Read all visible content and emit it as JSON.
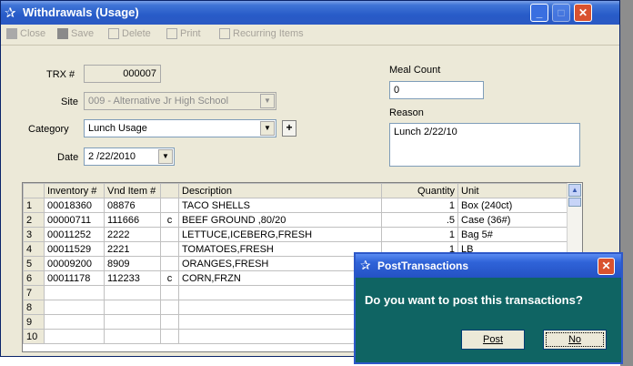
{
  "window": {
    "title": "Withdrawals (Usage)",
    "min": "_",
    "max": "□",
    "close": "✕"
  },
  "toolbar": {
    "close": "Close",
    "save": "Save",
    "delete": "Delete",
    "print": "Print",
    "recurring": "Recurring Items"
  },
  "form": {
    "trx_label": "TRX #",
    "trx_value": "000007",
    "site_label": "Site",
    "site_value": "009 - Alternative Jr High School",
    "category_label": "Category",
    "category_value": "Lunch Usage",
    "category_plus": "+",
    "date_label": "Date",
    "date_value": "2 /22/2010",
    "meal_count_label": "Meal Count",
    "meal_count_value": "0",
    "reason_label": "Reason",
    "reason_value": "Lunch 2/22/10"
  },
  "grid": {
    "columns": [
      "Inventory #",
      "Vnd Item #",
      "",
      "Description",
      "Quantity",
      "Unit"
    ],
    "rows": [
      {
        "n": "1",
        "inv": "00018360",
        "vnd": "08876",
        "c": "",
        "desc": "TACO SHELLS",
        "qty": "1",
        "unit": "Box (240ct)"
      },
      {
        "n": "2",
        "inv": "00000711",
        "vnd": "111666",
        "c": "c",
        "desc": "BEEF GROUND ,80/20",
        "qty": ".5",
        "unit": "Case (36#)"
      },
      {
        "n": "3",
        "inv": "00011252",
        "vnd": "2222",
        "c": "",
        "desc": "LETTUCE,ICEBERG,FRESH",
        "qty": "1",
        "unit": "Bag 5#"
      },
      {
        "n": "4",
        "inv": "00011529",
        "vnd": "2221",
        "c": "",
        "desc": "TOMATOES,FRESH",
        "qty": "1",
        "unit": "LB"
      },
      {
        "n": "5",
        "inv": "00009200",
        "vnd": "8909",
        "c": "",
        "desc": "ORANGES,FRESH",
        "qty": "",
        "unit": ""
      },
      {
        "n": "6",
        "inv": "00011178",
        "vnd": "112233",
        "c": "c",
        "desc": "CORN,FRZN",
        "qty": "",
        "unit": ""
      },
      {
        "n": "7",
        "inv": "",
        "vnd": "",
        "c": "",
        "desc": "",
        "qty": "",
        "unit": ""
      },
      {
        "n": "8",
        "inv": "",
        "vnd": "",
        "c": "",
        "desc": "",
        "qty": "",
        "unit": ""
      },
      {
        "n": "9",
        "inv": "",
        "vnd": "",
        "c": "",
        "desc": "",
        "qty": "",
        "unit": ""
      },
      {
        "n": "10",
        "inv": "",
        "vnd": "",
        "c": "",
        "desc": "",
        "qty": "",
        "unit": ""
      }
    ]
  },
  "dialog": {
    "title": "PostTransactions",
    "message": "Do you want to post this transactions?",
    "post": "Post",
    "no": "No",
    "close": "✕"
  }
}
